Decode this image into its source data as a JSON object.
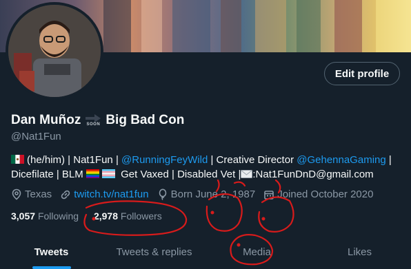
{
  "profile": {
    "display_name_part1": "Dan Muñoz",
    "arrow_caption": "SOON",
    "display_name_part2": "Big Bad Con",
    "handle": "@Nat1Fun",
    "edit_button": "Edit profile",
    "bio": {
      "seg1": "(he/him) | Nat1Fun | ",
      "mention1": "@RunningFeyWild",
      "seg2": " | Creative Director ",
      "mention2": "@GehennaGaming",
      "seg3": " |",
      "seg4": "Dicefilate | BLM ",
      "seg5": " Get Vaxed | Disabled Vet |",
      "seg6": ":Nat1FunDnD@gmail.com"
    },
    "location": "Texas",
    "website": "twitch.tv/nat1fun",
    "born": "Born June 2, 1987",
    "joined": "Joined October 2020",
    "following_count": "3,057",
    "following_label": "Following",
    "followers_count": "2,978",
    "followers_label": "Followers"
  },
  "tabs": [
    "Tweets",
    "Tweets & replies",
    "Media",
    "Likes"
  ],
  "active_tab": "Tweets",
  "icons": [
    "location-icon",
    "link-icon",
    "balloon-icon",
    "calendar-icon",
    "mexico-flag-icon",
    "envelope-icon",
    "pride-flag-icon",
    "trans-flag-icon",
    "arrow-icon"
  ],
  "colors": {
    "background": "#15202b",
    "accent": "#1d9bf0",
    "text": "#f7f9f9",
    "muted": "#8b98a5",
    "annotation": "#d81b1b"
  }
}
